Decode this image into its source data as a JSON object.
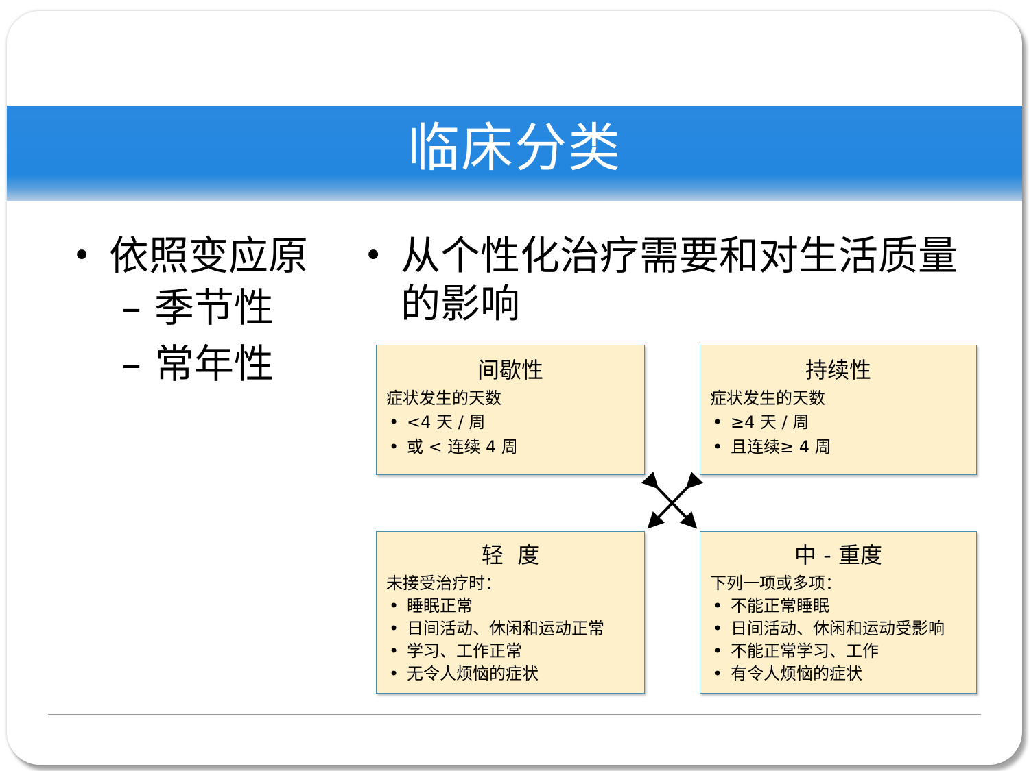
{
  "slide": {
    "title": "临床分类",
    "left_bullet": {
      "text": "依照变应原",
      "subitems": [
        "季节性",
        "常年性"
      ]
    },
    "right_bullet": {
      "line1": "从个性化治疗需要和对生活质量",
      "line2": "的影响"
    },
    "boxes": {
      "intermittent": {
        "title": "间歇性",
        "subtitle": "症状发生的天数",
        "items": [
          "<4 天 / 周",
          "或 < 连续 4 周"
        ]
      },
      "persistent": {
        "title": "持续性",
        "subtitle": "症状发生的天数",
        "items": [
          "≥4 天 / 周",
          "且连续≥ 4 周"
        ]
      },
      "mild": {
        "title": "轻  度",
        "subtitle": "未接受治疗时：",
        "items": [
          "睡眠正常",
          "日间活动、休闲和运动正常",
          "学习、工作正常",
          "无令人烦恼的症状"
        ]
      },
      "moderate_severe": {
        "title": "中 - 重度",
        "subtitle": "下列一项或多项：",
        "items": [
          "不能正常睡眠",
          "日间活动、休闲和运动受影响",
          "不能正常学习、工作",
          "有令人烦恼的症状"
        ]
      }
    },
    "bullet_glyph": "•",
    "dash_glyph": "–",
    "colors": {
      "title_band": "#2387df",
      "title_text": "#ffffff",
      "box_fill": "#fdf0cb",
      "box_border": "#4a8fb3"
    }
  }
}
